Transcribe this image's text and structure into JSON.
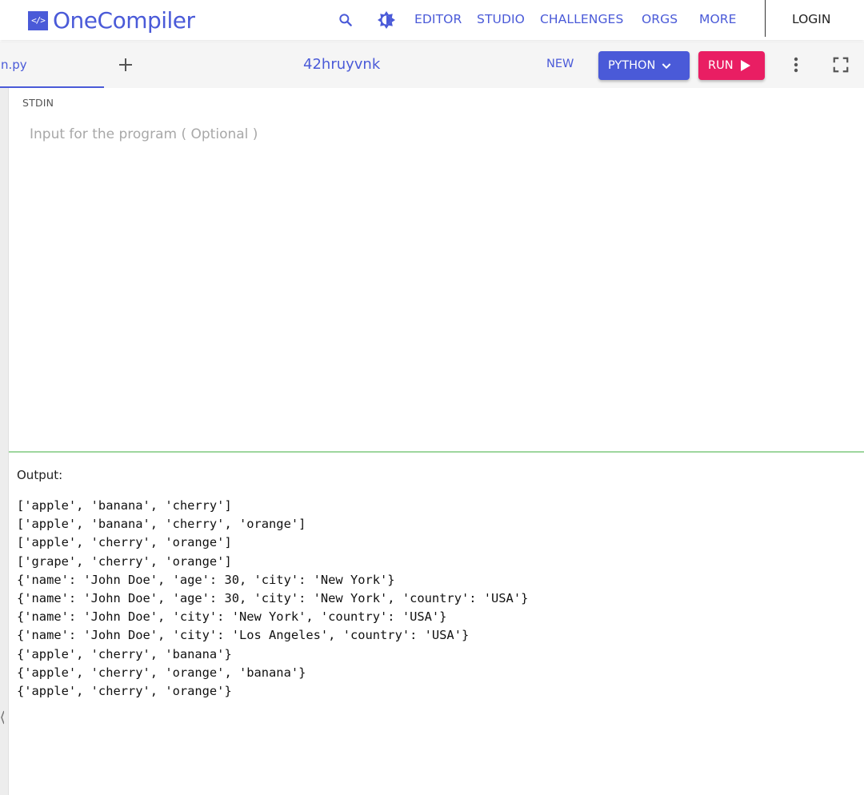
{
  "brand": {
    "logo_glyph": "</>",
    "name": "OneCompiler",
    "color": "#4a5ad8"
  },
  "nav": {
    "icons": [
      "search-icon",
      "theme-toggle-icon"
    ],
    "links": [
      "EDITOR",
      "STUDIO",
      "CHALLENGES",
      "ORGS",
      "MORE"
    ],
    "login": "LOGIN"
  },
  "toolbar": {
    "file_tab": "n.py",
    "project_name": "42hruyvnk",
    "new_label": "NEW",
    "language_label": "PYTHON",
    "run_label": "RUN",
    "run_color": "#e91e63",
    "icons": [
      "add-tab-icon",
      "more-vert-icon",
      "fullscreen-icon"
    ]
  },
  "stdin": {
    "label": "STDIN",
    "placeholder": "Input for the program ( Optional )"
  },
  "output": {
    "label": "Output:",
    "lines": [
      "['apple', 'banana', 'cherry']",
      "['apple', 'banana', 'cherry', 'orange']",
      "['apple', 'cherry', 'orange']",
      "['grape', 'cherry', 'orange']",
      "{'name': 'John Doe', 'age': 30, 'city': 'New York'}",
      "{'name': 'John Doe', 'age': 30, 'city': 'New York', 'country': 'USA'}",
      "{'name': 'John Doe', 'city': 'New York', 'country': 'USA'}",
      "{'name': 'John Doe', 'city': 'Los Angeles', 'country': 'USA'}",
      "{'apple', 'cherry', 'banana'}",
      "{'apple', 'cherry', 'orange', 'banana'}",
      "{'apple', 'cherry', 'orange'}"
    ]
  }
}
